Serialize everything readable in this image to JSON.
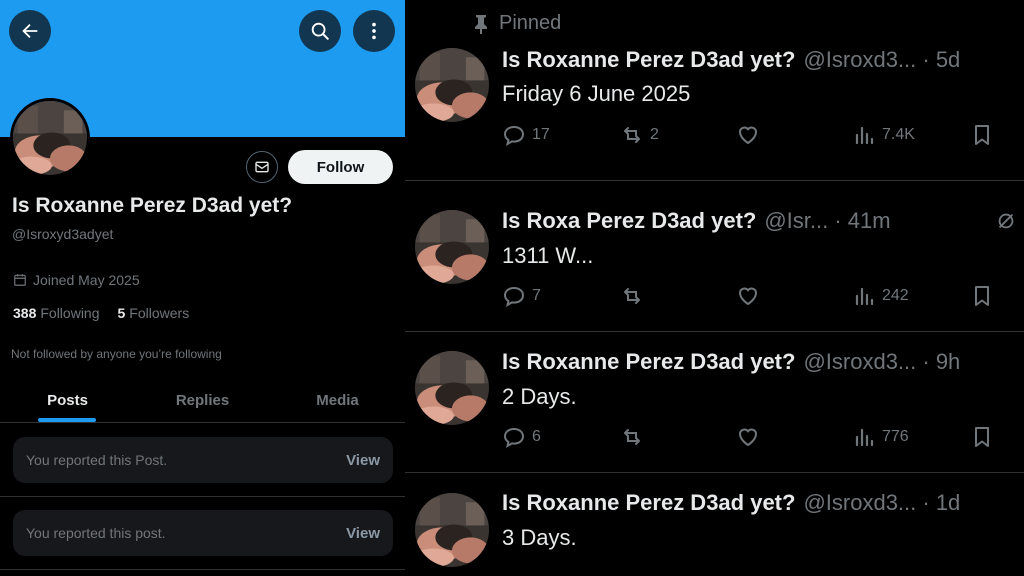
{
  "profile": {
    "display_name": "Is Roxanne Perez D3ad yet?",
    "handle": "@Isroxyd3adyet",
    "joined": "Joined May 2025",
    "following_count": "388",
    "following_label": "Following",
    "followers_count": "5",
    "followers_label": "Followers",
    "not_followed": "Not followed by anyone you’re following",
    "follow_label": "Follow",
    "banner_color": "#1d9bf0"
  },
  "tabs": [
    "Posts",
    "Replies",
    "Media"
  ],
  "reported_items": [
    {
      "message": "You reported this Post.",
      "action": "View"
    },
    {
      "message": "You reported this post.",
      "action": "View"
    }
  ],
  "timeline": {
    "pinned_label": "Pinned",
    "posts": [
      {
        "name": "Is Roxanne Perez D3ad yet?",
        "meta": "@Isroxd3... · 5d",
        "body": "Friday 6 June 2025",
        "replies": "17",
        "reposts": "2",
        "likes": "",
        "views": "7.4K"
      },
      {
        "name": "Is Roxa      Perez D3ad yet?",
        "meta": "@Isr... · 41m",
        "body": "1311 W...",
        "replies": "7",
        "reposts": "",
        "likes": "",
        "views": "242"
      },
      {
        "name": "Is Roxanne Perez D3ad yet?",
        "meta": "@Isroxd3... · 9h",
        "body": "2 Days.",
        "replies": "6",
        "reposts": "",
        "likes": "",
        "views": "776"
      },
      {
        "name": "Is Roxanne Perez D3ad yet?",
        "meta": "@Isroxd3... · 1d",
        "body": "3 Days.",
        "replies": "",
        "reposts": "",
        "likes": "",
        "views": ""
      }
    ]
  },
  "icons": {
    "back": "arrow-left-icon",
    "search": "search-icon",
    "more": "more-vertical-icon",
    "message": "envelope-icon",
    "calendar": "calendar-icon",
    "pin": "pin-icon",
    "reply": "reply-icon",
    "repost": "repost-icon",
    "like": "heart-icon",
    "views": "views-icon",
    "bookmark": "bookmark-icon",
    "mute": "mute-icon"
  },
  "colors": {
    "accent": "#1d9bf0",
    "muted": "#71767b",
    "text": "#e7e9ea",
    "background": "#000000"
  }
}
